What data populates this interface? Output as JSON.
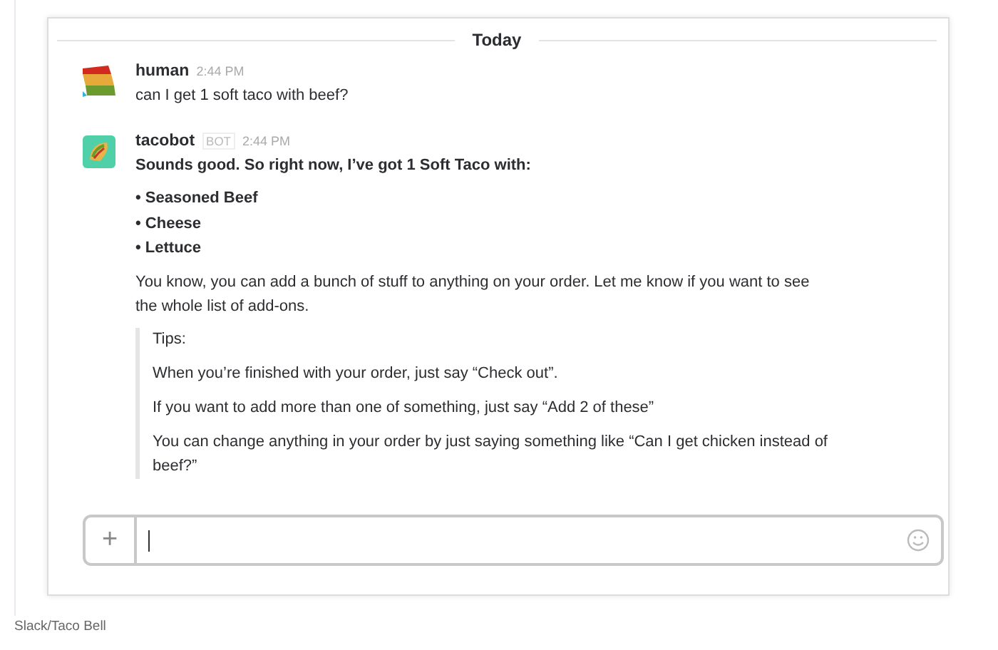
{
  "day_divider": "Today",
  "messages": [
    {
      "author": "human",
      "kind": "user",
      "time": "2:44 PM",
      "blocks": [
        {
          "kind": "text",
          "text": "can I get 1 soft taco with beef?"
        }
      ]
    },
    {
      "author": "tacobot",
      "kind": "bot",
      "bot_badge": "BOT",
      "time": "2:44 PM",
      "blocks": [
        {
          "kind": "bold",
          "text": "Sounds good. So right now, I’ve got 1 Soft Taco with:"
        },
        {
          "kind": "bullet",
          "text": "• Seasoned Beef"
        },
        {
          "kind": "bullet",
          "text": "• Cheese"
        },
        {
          "kind": "bullet",
          "text": "• Lettuce"
        },
        {
          "kind": "text",
          "text": "You know, you can add a bunch of stuff to anything on your order. Let me know if you want to see the whole list of add-ons."
        },
        {
          "kind": "quote",
          "lines": [
            "Tips:",
            "When you’re finished with your order, just say “Check out”.",
            "If you want to add more than one of something, just say “Add 2 of these”",
            "You can change anything in your order by just saying something like “Can I get chicken instead of beef?”"
          ]
        }
      ]
    }
  ],
  "composer": {
    "plus": "+"
  },
  "caption": "Slack/Taco Bell"
}
